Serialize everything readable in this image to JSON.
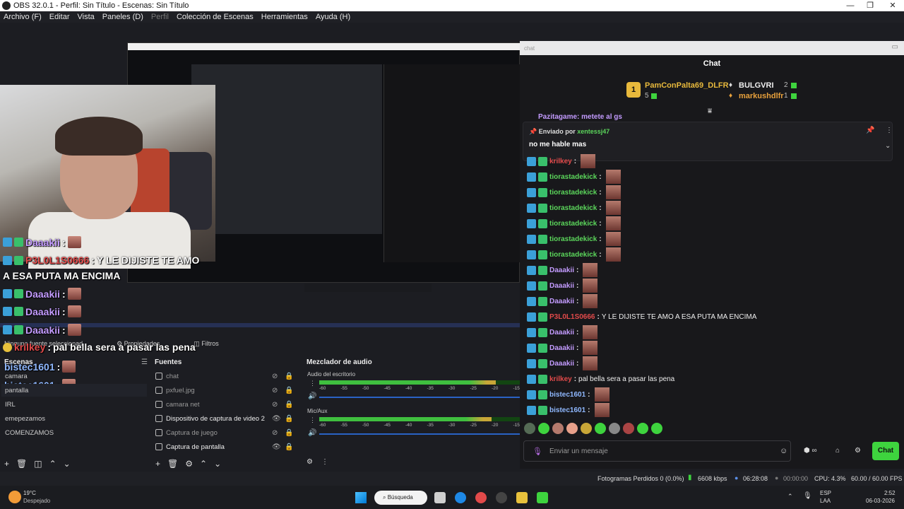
{
  "titlebar": {
    "title": "OBS 32.0.1 - Perfil: Sin Título - Escenas: Sin Título",
    "minimize": "—",
    "maximize": "❐",
    "close": "✕"
  },
  "menu": [
    "Archivo (F)",
    "Editar",
    "Vista",
    "Paneles (D)",
    "Perfil",
    "Colección de Escenas",
    "Herramientas",
    "Ayuda (H)"
  ],
  "overlay_chat": [
    {
      "user": "Daaakii",
      "text": ""
    },
    {
      "user": "P3L0L1S0666",
      "text": "Y LE DIJISTE TE AMO"
    },
    {
      "user": "",
      "text": "A ESA PUTA MA ENCIMA"
    },
    {
      "user": "Daaakii",
      "text": ""
    },
    {
      "user": "Daaakii",
      "text": ""
    },
    {
      "user": "Daaakii",
      "text": ""
    },
    {
      "user": "krilkey",
      "text": "pal bella sera a pasar las pena"
    },
    {
      "user": "bistec1601",
      "text": ""
    },
    {
      "user": "bistec1601",
      "text": ""
    }
  ],
  "source_info": {
    "none_selected": "Ninguna fuente seleccionad",
    "properties": "Propiedades",
    "filters": "Filtros"
  },
  "scenes": {
    "title": "Escenas",
    "items": [
      "camara",
      "pantalla",
      "IRL",
      "emepezamos",
      "COMENZAMOS"
    ]
  },
  "sources": {
    "title": "Fuentes",
    "items": [
      "chat",
      "pxfuel.jpg",
      "camara net",
      "Dispositivo de captura de video 2",
      "Captura de juego",
      "Captura de pantalla"
    ]
  },
  "mixer": {
    "title": "Mezclador de audio",
    "channels": [
      {
        "name": "Audio del escritorio",
        "level": 0.88
      },
      {
        "name": "Mic/Aux",
        "level": 0.86
      }
    ],
    "scale": [
      "-60",
      "-55",
      "-50",
      "-45",
      "-40",
      "-35",
      "-30",
      "-25",
      "-20",
      "-15"
    ]
  },
  "chat": {
    "window_title": "chat",
    "header": "Chat",
    "leaderboard": [
      {
        "rank": "1",
        "name": "PamConPalta69_DLFR",
        "count": "5"
      },
      {
        "rank": "",
        "name": "BULGVRI",
        "count": "2"
      },
      {
        "rank": "",
        "name": "markushdlfr",
        "count": "1"
      }
    ],
    "partial_line": "Pazitagame: metete al gs",
    "pinned": {
      "label": "Enviado por",
      "author": "xentessj47",
      "message": "no me hable mas"
    },
    "messages": [
      {
        "user": "krilkey",
        "text": "",
        "color": "#e24a4a"
      },
      {
        "user": "tiorastadekick",
        "text": "",
        "color": "#5bd65b"
      },
      {
        "user": "tiorastadekick",
        "text": "",
        "color": "#5bd65b"
      },
      {
        "user": "tiorastadekick",
        "text": "",
        "color": "#5bd65b"
      },
      {
        "user": "tiorastadekick",
        "text": "",
        "color": "#5bd65b"
      },
      {
        "user": "tiorastadekick",
        "text": "",
        "color": "#5bd65b"
      },
      {
        "user": "tiorastadekick",
        "text": "",
        "color": "#5bd65b"
      },
      {
        "user": "Daaakii",
        "text": "",
        "color": "#c39bff"
      },
      {
        "user": "Daaakii",
        "text": "",
        "color": "#c39bff"
      },
      {
        "user": "Daaakii",
        "text": "",
        "color": "#c39bff"
      },
      {
        "user": "P3L0L1S0666",
        "text": "Y LE DIJISTE TE AMO A ESA PUTA MA ENCIMA",
        "color": "#e24a4a"
      },
      {
        "user": "Daaakii",
        "text": "",
        "color": "#c39bff"
      },
      {
        "user": "Daaakii",
        "text": "",
        "color": "#c39bff"
      },
      {
        "user": "Daaakii",
        "text": "",
        "color": "#c39bff"
      },
      {
        "user": "krilkey",
        "text": "pal bella sera a pasar las pena",
        "color": "#e24a4a"
      },
      {
        "user": "bistec1601",
        "text": "",
        "color": "#8fb8ff"
      },
      {
        "user": "bistec1601",
        "text": "",
        "color": "#8fb8ff"
      }
    ],
    "input_placeholder": "Enviar un mensaje",
    "send_label": "Chat",
    "accent": "#3ed33e"
  },
  "statusbar": {
    "dropped": "Fotogramas Perdidos 0 (0.0%)",
    "bitrate": "6608 kbps",
    "live_time": "06:28:08",
    "rec_time": "00:00:00",
    "cpu": "CPU: 4.3%",
    "fps": "60.00 / 60.00 FPS"
  },
  "taskbar": {
    "weather_temp": "19°C",
    "weather_desc": "Despejado",
    "search": "Búsqueda",
    "lang": "ESP",
    "lang2": "LAA",
    "time": "2:52",
    "date": "06-03-2026"
  }
}
